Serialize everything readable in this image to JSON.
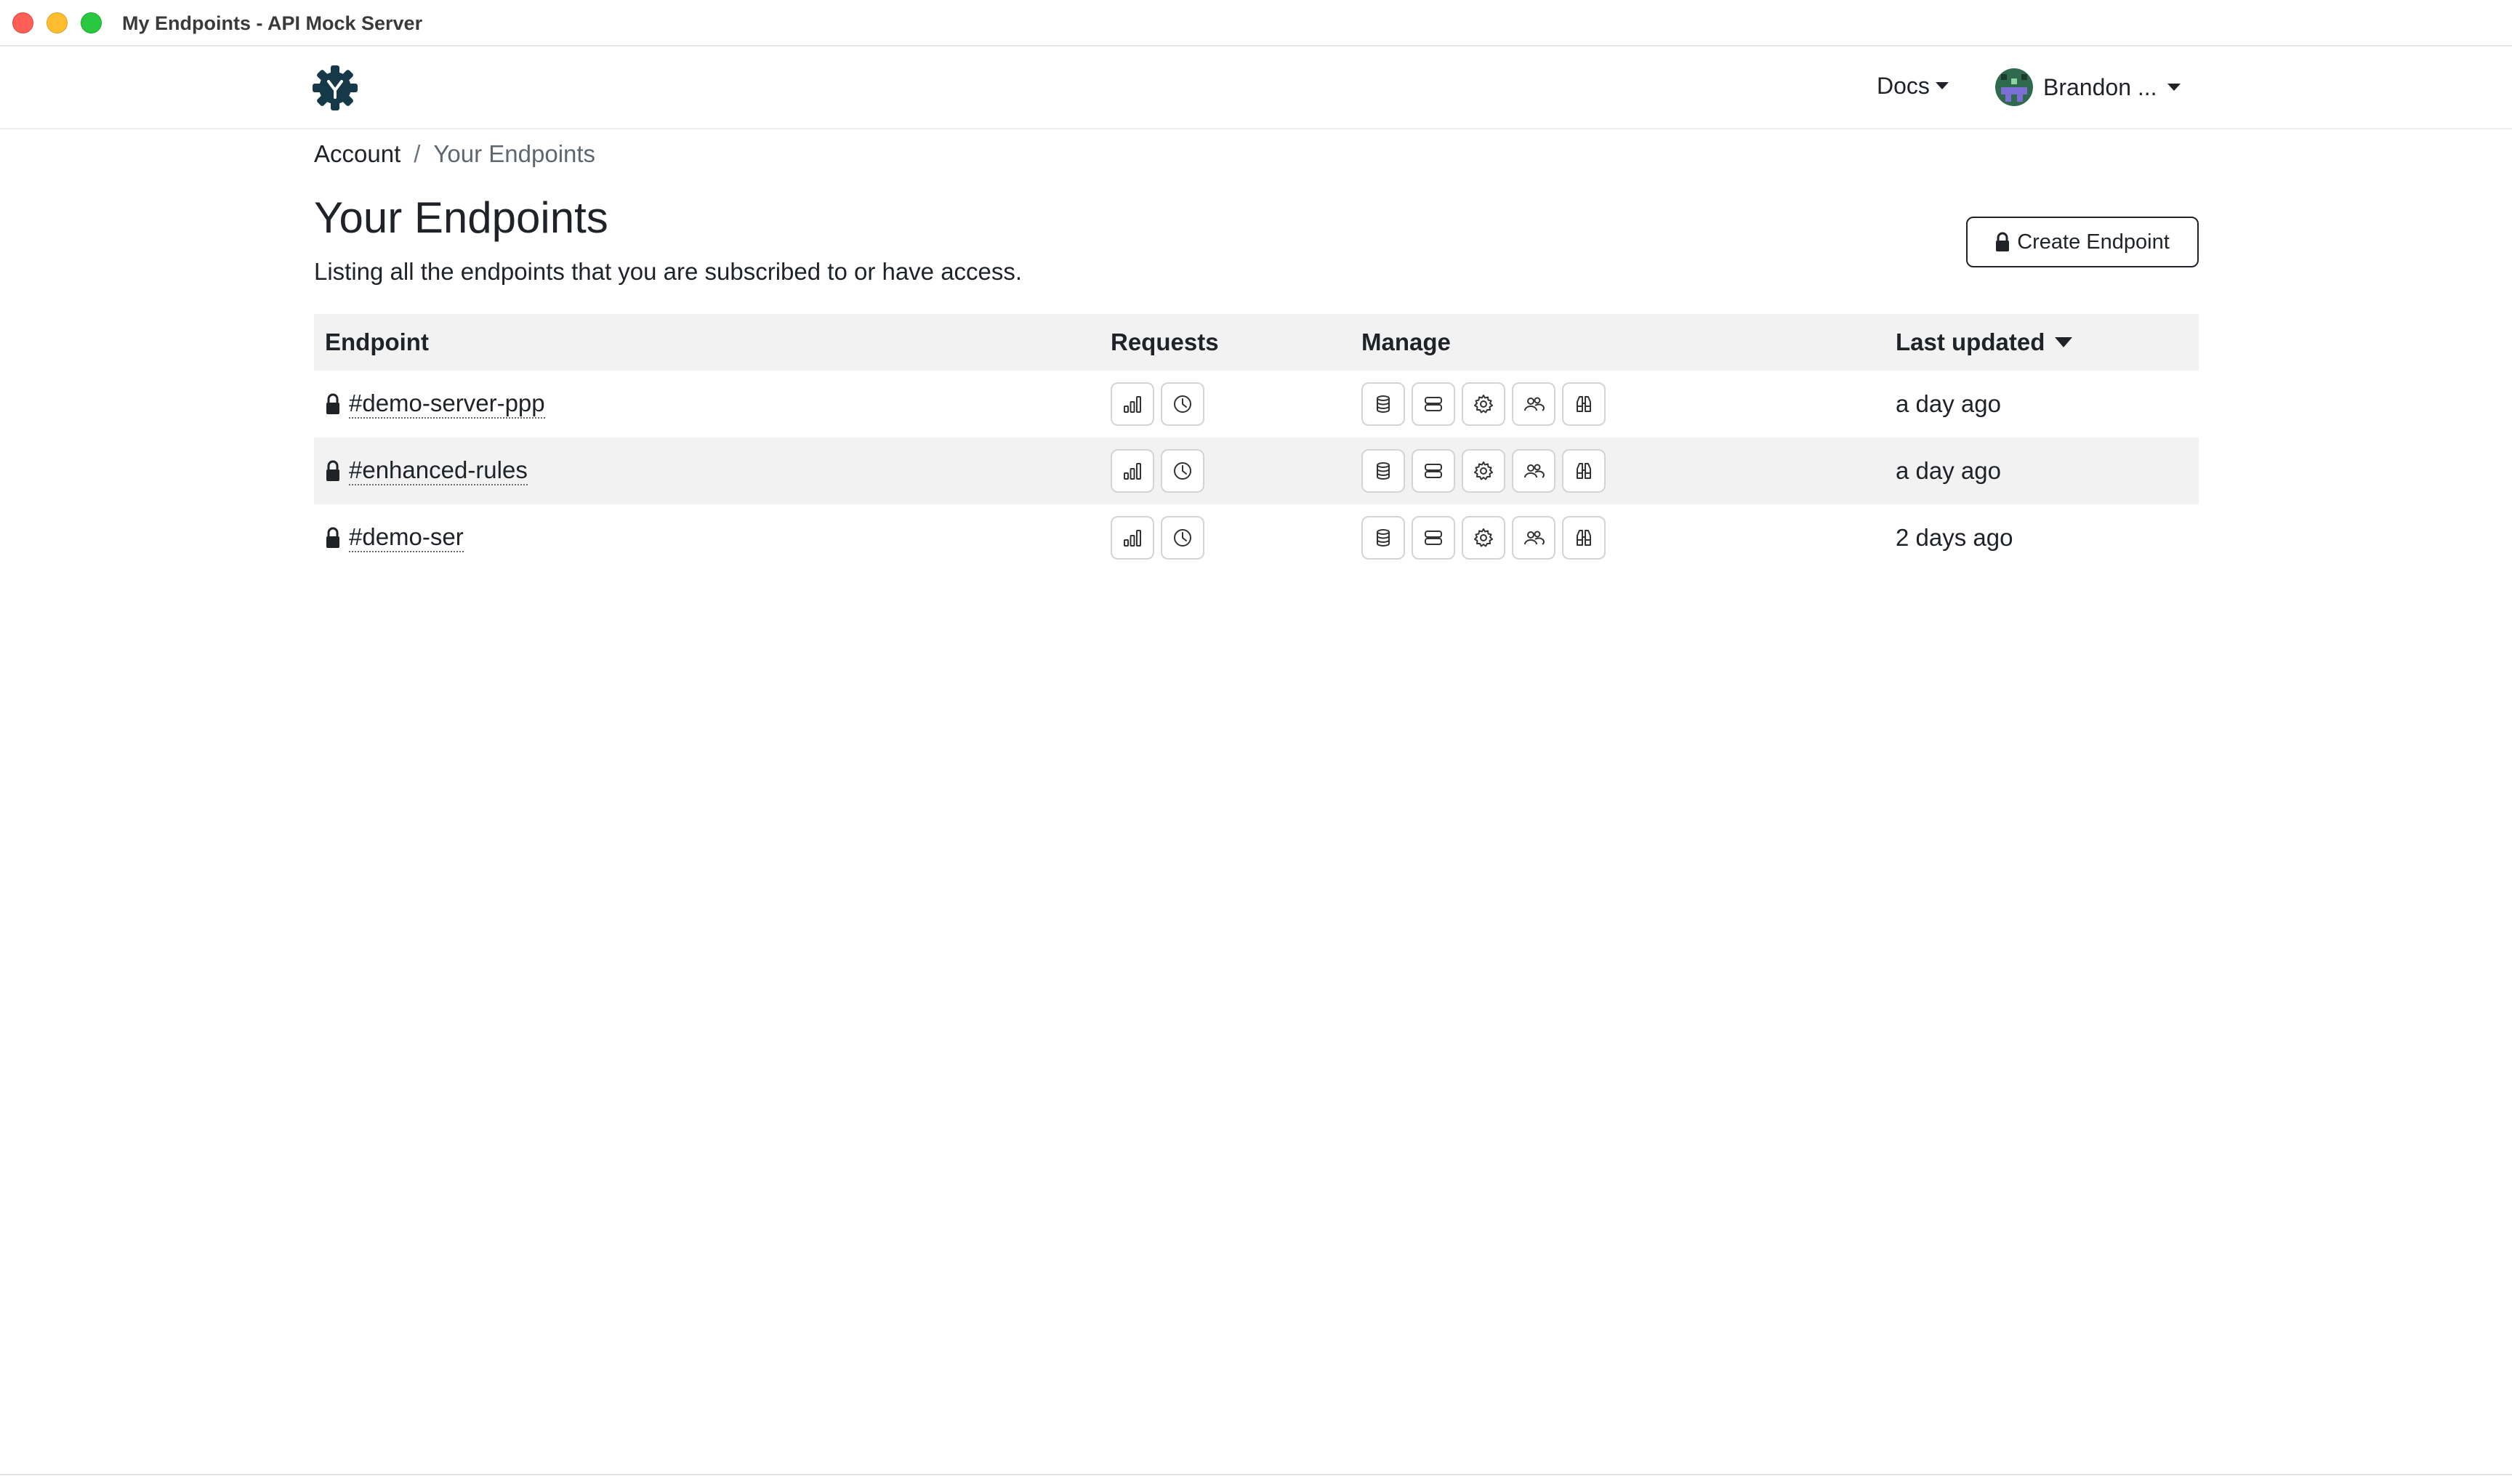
{
  "window": {
    "title": "My Endpoints - API Mock Server"
  },
  "nav": {
    "docs_label": "Docs",
    "user_name": "Brandon ..."
  },
  "breadcrumb": {
    "account": "Account",
    "separator": "/",
    "current": "Your Endpoints"
  },
  "page": {
    "title": "Your Endpoints",
    "subtitle": "Listing all the endpoints that you are subscribed to or have access.",
    "create_button": "Create Endpoint"
  },
  "table": {
    "headers": {
      "endpoint": "Endpoint",
      "requests": "Requests",
      "manage": "Manage",
      "last_updated": "Last updated"
    },
    "rows": [
      {
        "name": "#demo-server-ppp",
        "updated": "a day ago"
      },
      {
        "name": "#enhanced-rules",
        "updated": "a day ago"
      },
      {
        "name": "#demo-ser",
        "updated": "2 days ago"
      }
    ],
    "request_icons": [
      "bar-chart-icon",
      "clock-icon"
    ],
    "manage_icons": [
      "database-icon",
      "server-icon",
      "gear-icon",
      "users-icon",
      "binoculars-icon"
    ]
  },
  "colors": {
    "logo": "#16394a",
    "text": "#1f2328",
    "header_bg": "#f2f2f2",
    "icon_border": "#d4d4d4"
  }
}
